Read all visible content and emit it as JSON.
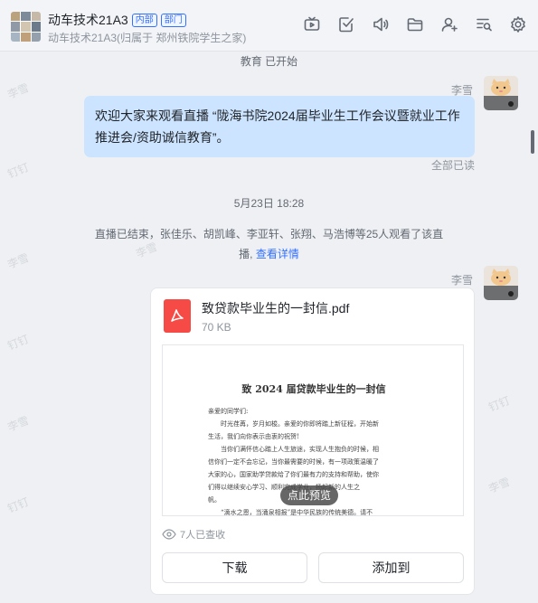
{
  "header": {
    "title": "动车技术21A3",
    "tags": [
      "内部",
      "部门"
    ],
    "subtitle": "动车技术21A3(归属于 郑州铁院学生之家)",
    "toolbar_icons": [
      "video-icon",
      "task-check-icon",
      "announcement-icon",
      "folder-icon",
      "add-member-icon",
      "search-chat-icon",
      "settings-icon"
    ]
  },
  "chat": {
    "watermark": "李雪",
    "watermark2": "钉钉",
    "top_partial": "教育 已开始",
    "msg1": {
      "sender": "李雪",
      "text": "欢迎大家来观看直播 “陇海书院2024届毕业生工作会议暨就业工作推进会/资助诚信教育”。",
      "status": "全部已读"
    },
    "timestamp": "5月23日 18:28",
    "live_end_text": "直播已结束，张佳乐、胡凯峰、李亚轩、张翔、马浩博等25人观看了该直播,",
    "live_end_line1": "直播已结束，张佳乐、胡凯峰、李亚轩、张翔、马浩博等25人观看了该直",
    "live_end_line2": "播,",
    "live_end_link": "查看详情",
    "msg2": {
      "sender": "李雪",
      "file_name": "致贷款毕业生的一封信.pdf",
      "file_size": "70 KB",
      "preview": {
        "doc_title": "致 2024 届贷款毕业生的一封信",
        "lines": [
          "亲爱的同学们:",
          "时光荏苒，岁月如梭。亲爱的你即将踏上新征程，开始新",
          "生活，我们向你表示由衷的祝贺!",
          "当你们满怀信心踏上人生旅途，实现人生抱负的时候，相",
          "信你们一定不会忘记，当你最需要的时候，有一项政策温暖了",
          "大家的心，国家助学贷款给了你们最有力的支持和帮助，使你",
          "们得以继续安心学习、顺利完成学业，扬起新的人生之",
          "帆。",
          "“滴水之恩，当涌泉相报”是中华民族的传统美德。请不"
        ],
        "preview_button": "点此预览"
      },
      "views": "7人已查收",
      "download_label": "下载",
      "add_to_label": "添加到"
    }
  }
}
